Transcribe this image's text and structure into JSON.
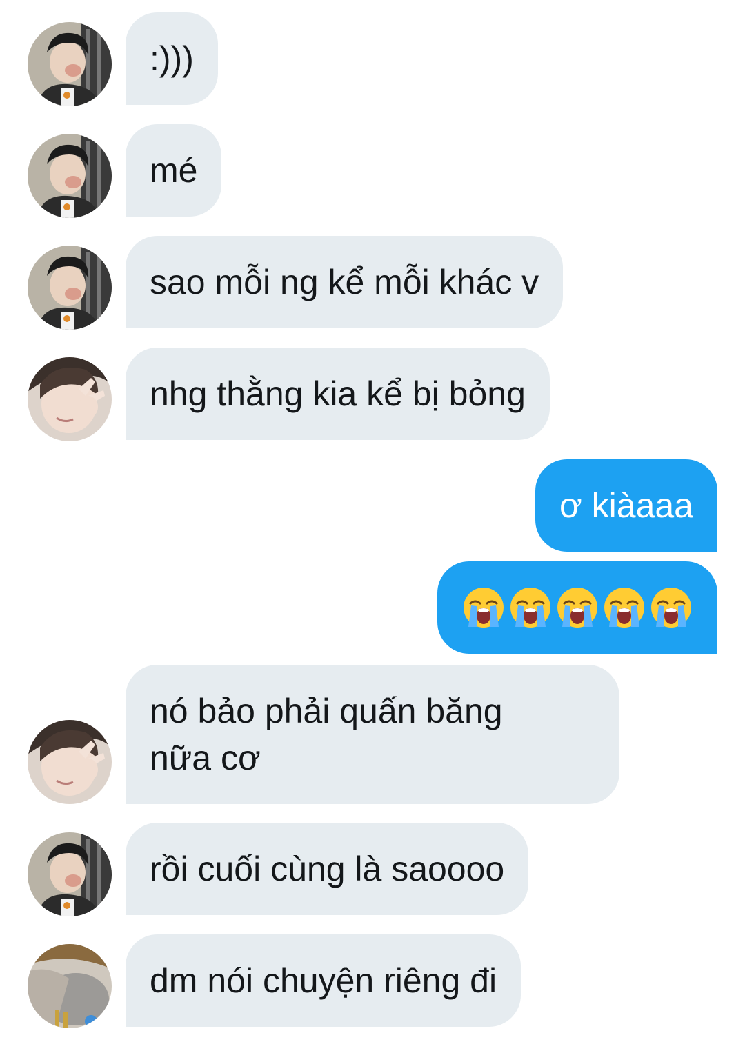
{
  "conversation": {
    "messages": [
      {
        "sender": "friend-a",
        "text": ":)))"
      },
      {
        "sender": "friend-a",
        "text": "mé"
      },
      {
        "sender": "friend-a",
        "text": "sao mỗi ng kể mỗi khác v"
      },
      {
        "sender": "friend-b",
        "text": "nhg thằng kia kể bị bỏng"
      },
      {
        "sender": "me",
        "text": "ơ kiàaaa"
      },
      {
        "sender": "me",
        "emoji": "loudly-crying-face",
        "emoji_count": 5
      },
      {
        "sender": "friend-b",
        "lines": [
          "nó bảo phải quấn băng",
          "nữa cơ"
        ]
      },
      {
        "sender": "friend-a",
        "text": "rồi cuối cùng là saoooo"
      },
      {
        "sender": "friend-c",
        "text": "dm nói chuyện riêng đi"
      }
    ]
  },
  "colors": {
    "incoming_bubble": "#e6ecf0",
    "outgoing_bubble": "#1da1f2",
    "incoming_text": "#14171a",
    "outgoing_text": "#ffffff"
  }
}
